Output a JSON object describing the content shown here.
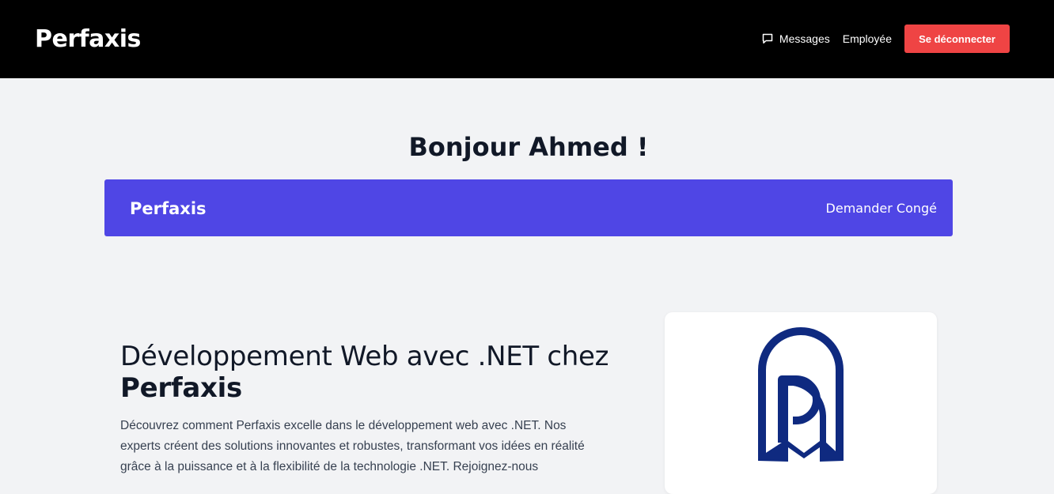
{
  "header": {
    "brand": "Perfaxis",
    "nav": {
      "messages_label": "Messages",
      "messages_icon": "chat-bubble-icon",
      "employee_label": "Employée",
      "logout_label": "Se déconnecter"
    }
  },
  "greeting": "Bonjour Ahmed !",
  "banner": {
    "brand": "Perfaxis",
    "leave_link": "Demander Congé"
  },
  "hero": {
    "title_prefix": "Développement Web avec .NET chez ",
    "title_brand": "Perfaxis",
    "description": "Découvrez comment Perfaxis excelle dans le développement web avec .NET. Nos experts créent des solutions innovantes et robustes, transformant vos idées en réalité grâce à la puissance et à la flexibilité de la technologie .NET. Rejoignez-nous"
  },
  "logo": {
    "icon": "perfaxis-logo-icon"
  },
  "colors": {
    "header_bg": "#000000",
    "page_bg": "#f2f3f5",
    "logout_button": "#ef4444",
    "banner_bg": "#4f46e5",
    "logo_blue": "#0f2a80",
    "text_dark": "#111827",
    "text_body": "#374151"
  }
}
